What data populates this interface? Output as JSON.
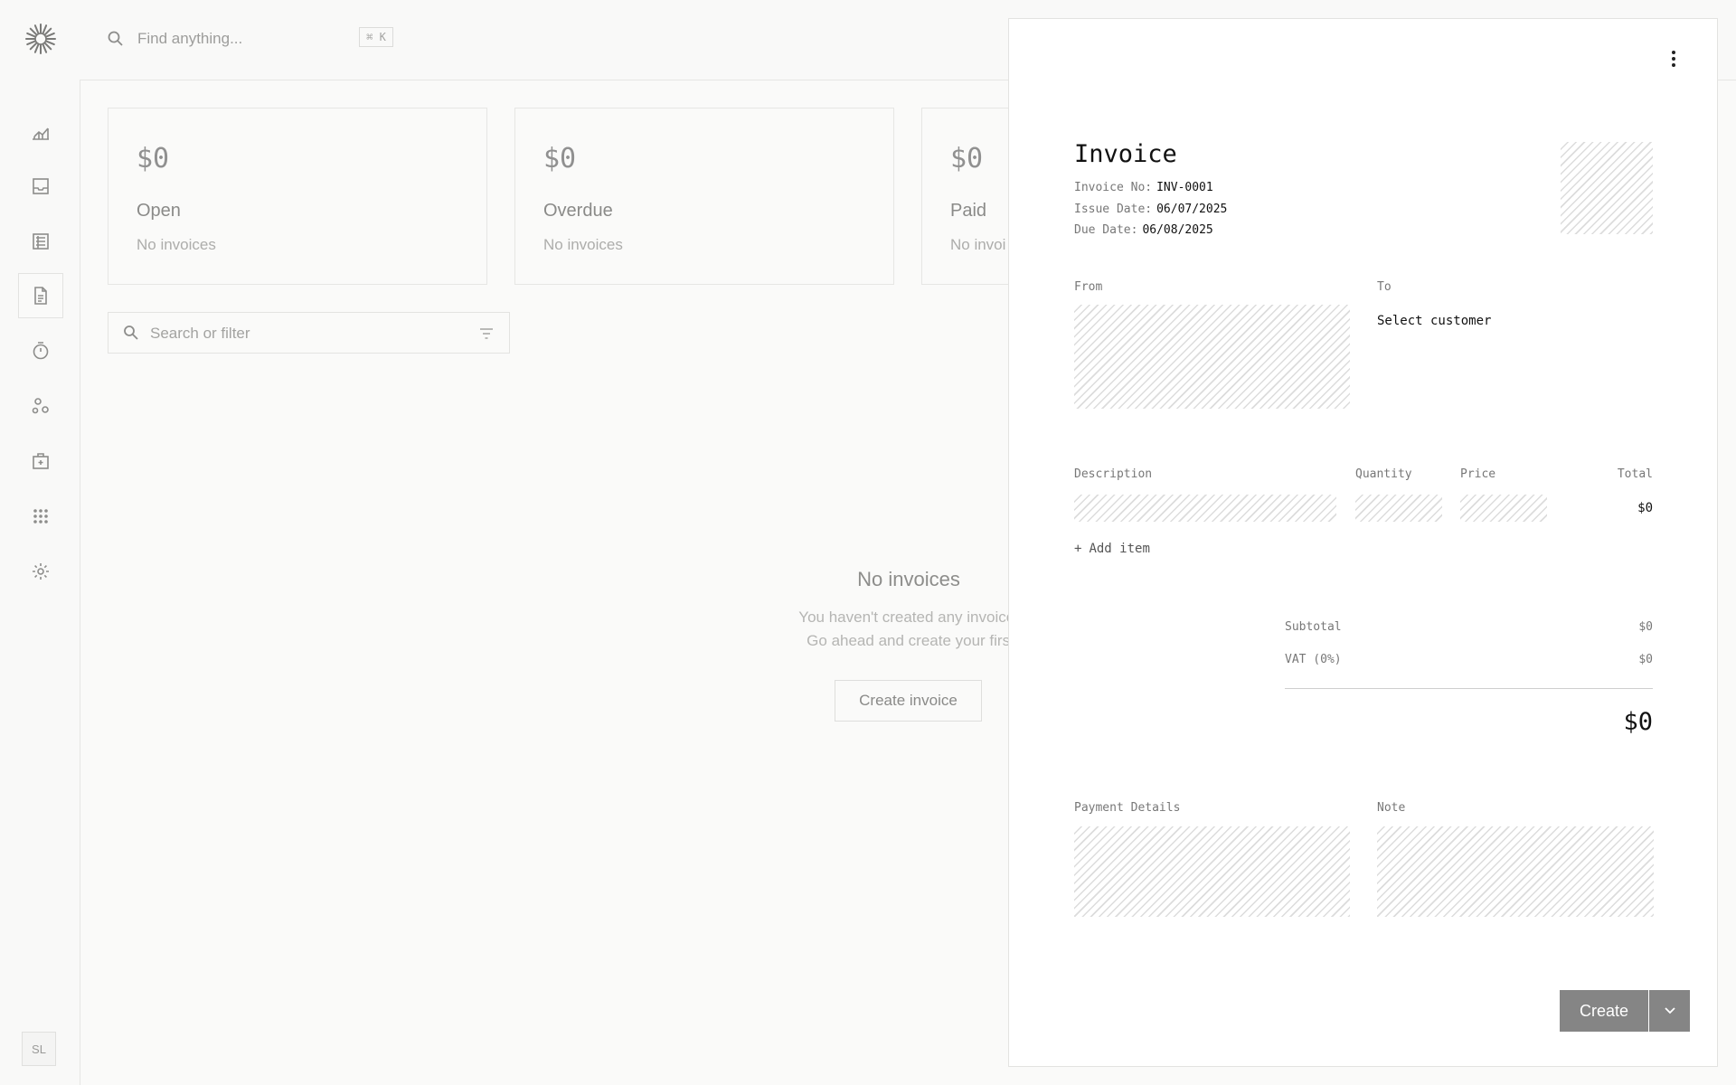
{
  "search": {
    "placeholder": "Find anything...",
    "shortcut": "⌘ K"
  },
  "user": {
    "initials": "SL"
  },
  "summary_cards": [
    {
      "amount": "$0",
      "label": "Open",
      "sub": "No invoices"
    },
    {
      "amount": "$0",
      "label": "Overdue",
      "sub": "No invoices"
    },
    {
      "amount": "$0",
      "label": "Paid",
      "sub": "No invoi"
    }
  ],
  "filter": {
    "placeholder": "Search or filter"
  },
  "empty_state": {
    "title": "No invoices",
    "line1": "You haven't created any invoices",
    "line2": "Go ahead and create your first",
    "button": "Create invoice"
  },
  "invoice": {
    "title": "Invoice",
    "invoice_no_label": "Invoice No:",
    "invoice_no": "INV-0001",
    "issue_date_label": "Issue Date:",
    "issue_date": "06/07/2025",
    "due_date_label": "Due Date:",
    "due_date": "06/08/2025",
    "from_label": "From",
    "to_label": "To",
    "to_value": "Select customer",
    "columns": {
      "description": "Description",
      "quantity": "Quantity",
      "price": "Price",
      "total": "Total"
    },
    "row_total": "$0",
    "add_item": "Add item",
    "subtotal_label": "Subtotal",
    "subtotal": "$0",
    "vat_label": "VAT (0%)",
    "vat": "$0",
    "grand_total": "$0",
    "payment_details_label": "Payment Details",
    "note_label": "Note",
    "create_button": "Create"
  },
  "icons": {
    "sidebar": [
      "chart-icon",
      "inbox-icon",
      "transactions-icon",
      "invoice-icon",
      "timer-icon",
      "customers-icon",
      "vault-icon",
      "apps-icon",
      "settings-icon"
    ]
  }
}
